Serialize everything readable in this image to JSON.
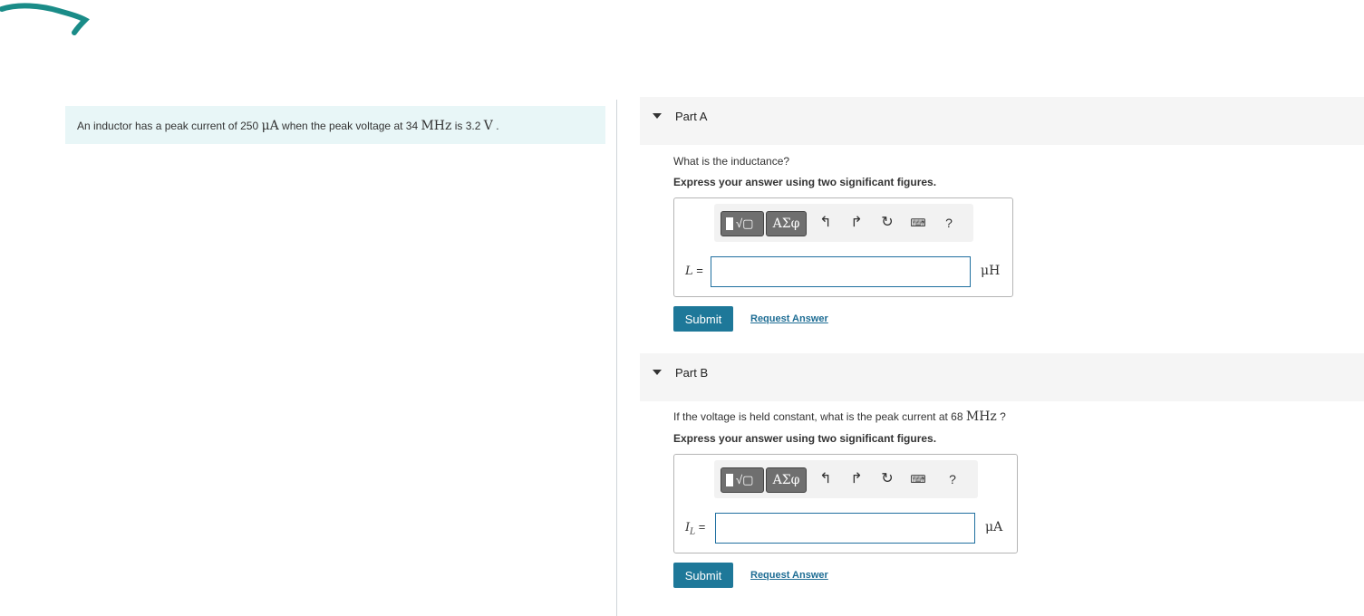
{
  "problem": {
    "text_before_current": "An inductor has a peak current of 250 ",
    "current_unit": "μA",
    "text_before_freq": " when the peak voltage at 34 ",
    "freq_unit": "MHz",
    "text_before_voltage": " is 3.2 ",
    "voltage_unit": "V",
    "text_end": " ."
  },
  "parts": [
    {
      "title": "Part A",
      "question": "What is the inductance?",
      "question_unit": "",
      "question_end": "",
      "instruction": "Express your answer using two significant figures.",
      "toolbar": {
        "templates_label": "√▢",
        "greek_label": "ΑΣφ",
        "undo_icon": "↰",
        "redo_icon": "↱",
        "reset_icon": "↻",
        "keyboard_icon": "⌨",
        "help_label": "?"
      },
      "variable": "L",
      "variable_sub": "",
      "equals": " =",
      "input_value": "",
      "unit": "μH",
      "submit_label": "Submit",
      "request_label": "Request Answer"
    },
    {
      "title": "Part B",
      "question": "If the voltage is held constant, what is the peak current at 68 ",
      "question_unit": "MHz",
      "question_end": " ?",
      "instruction": "Express your answer using two significant figures.",
      "toolbar": {
        "templates_label": "√▢",
        "greek_label": "ΑΣφ",
        "undo_icon": "↰",
        "redo_icon": "↱",
        "reset_icon": "↻",
        "keyboard_icon": "⌨",
        "help_label": "?"
      },
      "variable": "I",
      "variable_sub": "L",
      "equals": " =",
      "input_value": "",
      "unit": "μA",
      "submit_label": "Submit",
      "request_label": "Request Answer"
    }
  ],
  "colors": {
    "problem_bg": "#e8f6f7",
    "submit_bg": "#1e7899",
    "link": "#1e6d94",
    "scribble": "#1a8c88"
  }
}
